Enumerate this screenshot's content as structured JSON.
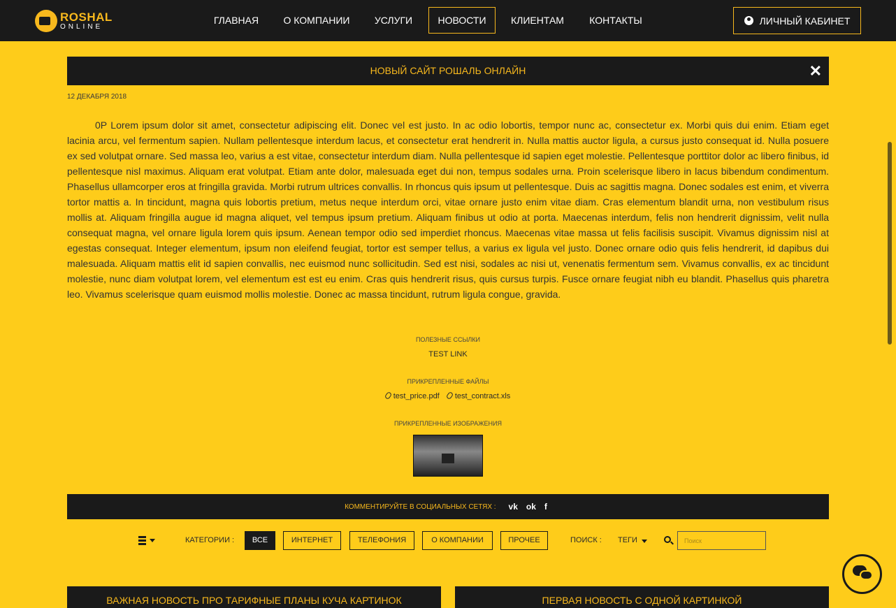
{
  "logo": {
    "line1": "ROSHAL",
    "line2": "ONLINE"
  },
  "nav": {
    "items": [
      {
        "label": "ГЛАВНАЯ"
      },
      {
        "label": "О КОМПАНИИ"
      },
      {
        "label": "УСЛУГИ"
      },
      {
        "label": "НОВОСТИ",
        "active": true
      },
      {
        "label": "КЛИЕНТАМ"
      },
      {
        "label": "КОНТАКТЫ"
      }
    ],
    "cabinet_label": "ЛИЧНЫЙ КАБИНЕТ"
  },
  "article": {
    "title": "НОВЫЙ САЙТ РОШАЛЬ ОНЛАЙН",
    "close_symbol": "✕",
    "date": "12 ДЕКАБРЯ 2018",
    "body": "0P Lorem ipsum dolor sit amet, consectetur adipiscing elit. Donec vel est justo. In ac odio lobortis, tempor nunc ac, consectetur ex. Morbi quis dui enim. Etiam eget lacinia arcu, vel fermentum sapien. Nullam pellentesque interdum lacus, et consectetur erat hendrerit in. Nulla mattis auctor ligula, a cursus justo consequat id. Nulla posuere ex sed volutpat ornare. Sed massa leo, varius a est vitae, consectetur interdum diam. Nulla pellentesque id sapien eget molestie. Pellentesque porttitor dolor ac libero finibus, id pellentesque nisl maximus. Aliquam erat volutpat. Etiam ante dolor, malesuada eget dui non, tempus sodales urna. Proin scelerisque libero in lacus bibendum condimentum. Phasellus ullamcorper eros at fringilla gravida. Morbi rutrum ultrices convallis. In rhoncus quis ipsum ut pellentesque. Duis ac sagittis magna. Donec sodales est enim, et viverra tortor mattis a. In tincidunt, magna quis lobortis pretium, metus neque interdum orci, vitae ornare justo enim vitae diam. Cras elementum blandit urna, non vestibulum risus mollis at. Aliquam fringilla augue id magna aliquet, vel tempus ipsum pretium. Aliquam finibus ut odio at porta. Maecenas interdum, felis non hendrerit dignissim, velit nulla consequat magna, vel ornare ligula lorem quis ipsum. Aenean tempor odio sed imperdiet rhoncus. Maecenas vitae massa ut felis facilisis suscipit. Vivamus dignissim nisl at egestas consequat. Integer elementum, ipsum non eleifend feugiat, tortor est semper tellus, a varius ex ligula vel justo. Donec ornare odio quis felis hendrerit, id dapibus dui malesuada. Aliquam mattis elit id sapien convallis, nec euismod nunc sollicitudin. Sed est nisi, sodales ac nisi ut, venenatis fermentum sem. Vivamus convallis, ex ac tincidunt molestie, nunc diam volutpat lorem, vel elementum est est eu enim. Cras quis hendrerit risus, quis cursus turpis. Fusce ornare feugiat nibh eu blandit. Phasellus quis pharetra leo. Vivamus scelerisque quam euismod mollis molestie. Donec ac massa tincidunt, rutrum ligula congue, gravida.",
    "links_label": "ПОЛЕЗНЫЕ ССЫЛКИ",
    "link": "TEST LINK",
    "files_label": "ПРИКРЕПЛЕННЫЕ ФАЙЛЫ",
    "files": [
      "test_price.pdf",
      "test_contract.xls"
    ],
    "images_label": "ПРИКРЕПЛЕННЫЕ ИЗОБРАЖЕНИЯ"
  },
  "social": {
    "label": "КОММЕНТИРУЙТЕ В СОЦИАЛЬНЫХ СЕТЯХ :",
    "vk": "vk",
    "ok": "ok",
    "fb": "f"
  },
  "filter": {
    "categories_label": "КАТЕГОРИИ :",
    "chips": [
      "ВСЕ",
      "ИНТЕРНЕТ",
      "ТЕЛЕФОНИЯ",
      "О КОМПАНИИ",
      "ПРОЧЕЕ"
    ],
    "search_label": "ПОИСК :",
    "tags_label": "ТЕГИ",
    "search_placeholder": "Поиск"
  },
  "cards": [
    {
      "title": "ВАЖНАЯ НОВОСТЬ ПРО ТАРИФНЫЕ ПЛАНЫ КУЧА КАРТИНОК"
    },
    {
      "title": "ПЕРВАЯ НОВОСТЬ С ОДНОЙ КАРТИНКОЙ"
    }
  ]
}
